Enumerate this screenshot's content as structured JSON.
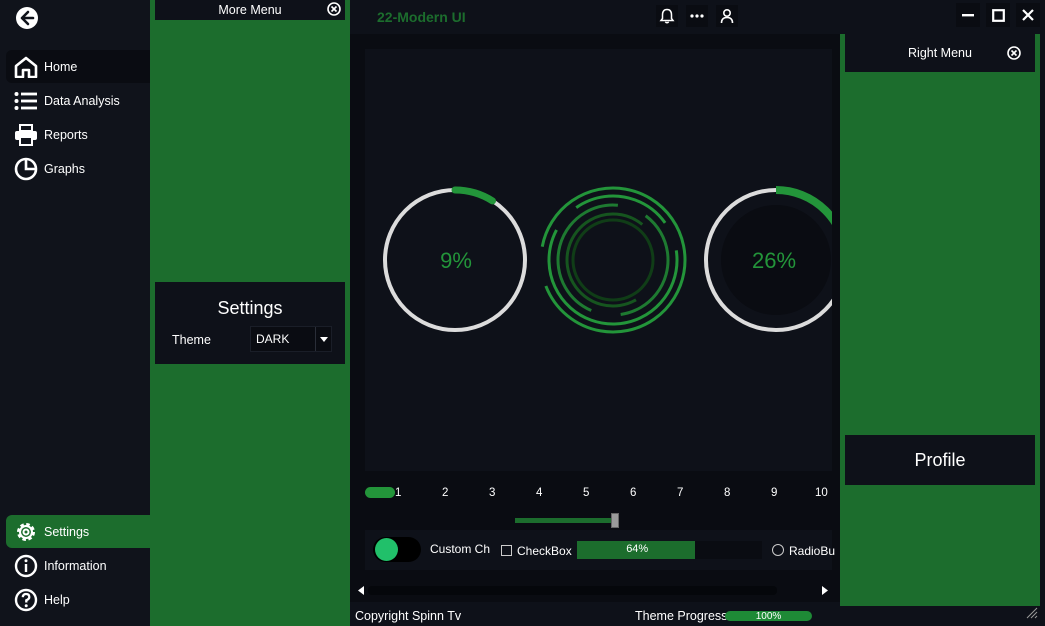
{
  "app": {
    "title": "22-Modern UI"
  },
  "sidebar": {
    "items": [
      {
        "label": "Home",
        "icon": "home-icon"
      },
      {
        "label": "Data Analysis",
        "icon": "list-icon"
      },
      {
        "label": "Reports",
        "icon": "printer-icon"
      },
      {
        "label": "Graphs",
        "icon": "pie-chart-icon"
      }
    ],
    "bottom_items": [
      {
        "label": "Settings",
        "icon": "gear-icon"
      },
      {
        "label": "Information",
        "icon": "info-icon"
      },
      {
        "label": "Help",
        "icon": "help-icon"
      }
    ]
  },
  "more_menu": {
    "title": "More Menu",
    "settings": {
      "title": "Settings",
      "theme_label": "Theme",
      "theme_value": "DARK"
    }
  },
  "right_menu": {
    "title": "Right Menu",
    "profile_label": "Profile"
  },
  "main": {
    "ring1": {
      "label": "9%",
      "value": 0.09
    },
    "ring3": {
      "label": "26%",
      "value": 0.26
    },
    "numbers": [
      "1",
      "2",
      "3",
      "4",
      "5",
      "6",
      "7",
      "8",
      "9",
      "10"
    ],
    "slider": {
      "value": 0.5
    },
    "toggle_label": "Custom Ch",
    "checkbox_label": "CheckBox",
    "progress": {
      "label": "64%",
      "value": 0.64
    },
    "radio_label": "RadioBu"
  },
  "footer": {
    "copyright": "Copyright Spinn Tv",
    "theme_progress_label": "Theme Progress",
    "theme_progress_value": "100%"
  },
  "colors": {
    "accent": "#1c6d2d",
    "ring_green": "#23953a",
    "bg": "#0e1119"
  }
}
